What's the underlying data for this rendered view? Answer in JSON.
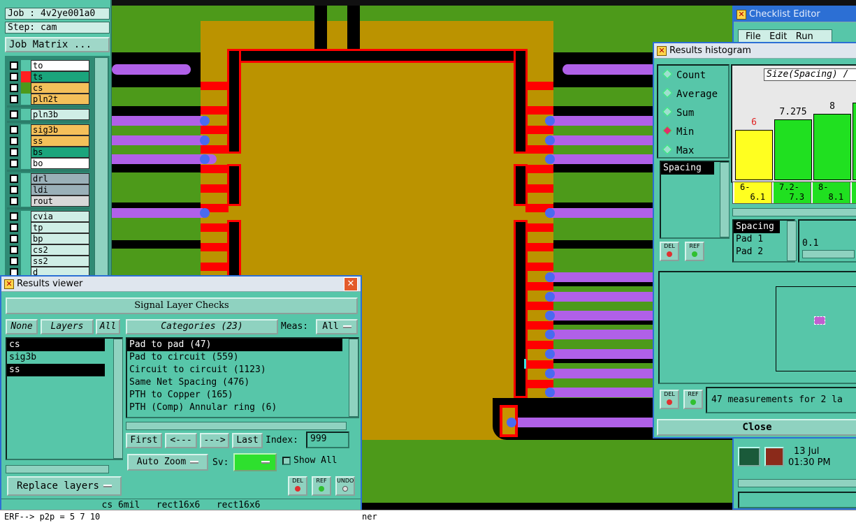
{
  "left_panel": {
    "job": "Job : 4v2ye001a0",
    "step": "Step: cam",
    "job_matrix": "Job Matrix ...",
    "layers": [
      {
        "name": "to",
        "color": "#ffffff",
        "swatch": "#57c6a9"
      },
      {
        "name": "ts",
        "color": "#1aa57c",
        "swatch": "#ff2020"
      },
      {
        "name": "cs",
        "color": "#f4c05a",
        "swatch": "#4d9a1a"
      },
      {
        "name": "pln2t",
        "color": "#f4c05a",
        "swatch": "#57c6a9"
      },
      {
        "name": "pln3b",
        "color": "#cfeee6",
        "swatch": "#57c6a9"
      },
      {
        "name": "sig3b",
        "color": "#f4c05a",
        "swatch": "#57c6a9"
      },
      {
        "name": "ss",
        "color": "#f4c05a",
        "swatch": "#57c6a9"
      },
      {
        "name": "bs",
        "color": "#1aa57c",
        "swatch": "#57c6a9"
      },
      {
        "name": "bo",
        "color": "#ffffff",
        "swatch": "#57c6a9"
      },
      {
        "name": "drl",
        "color": "#9ab0b8",
        "swatch": "#57c6a9"
      },
      {
        "name": "ldi",
        "color": "#9ab0b8",
        "swatch": "#57c6a9"
      },
      {
        "name": "rout",
        "color": "#d8d8d8",
        "swatch": "#57c6a9"
      },
      {
        "name": "cvia",
        "color": "#cfeee6",
        "swatch": "#57c6a9"
      },
      {
        "name": "tp",
        "color": "#cfeee6",
        "swatch": "#57c6a9"
      },
      {
        "name": "bp",
        "color": "#cfeee6",
        "swatch": "#57c6a9"
      },
      {
        "name": "cs2",
        "color": "#cfeee6",
        "swatch": "#57c6a9"
      },
      {
        "name": "ss2",
        "color": "#cfeee6",
        "swatch": "#57c6a9"
      },
      {
        "name": "d",
        "color": "#cfeee6",
        "swatch": "#57c6a9"
      }
    ]
  },
  "results_viewer": {
    "title": "Results viewer",
    "header": "Signal Layer Checks",
    "none_btn": "None",
    "layers_btn": "Layers",
    "all_btn": "All",
    "categories_btn": "Categories (23)",
    "meas_label": "Meas:",
    "meas_value": "All",
    "layer_list": [
      "cs",
      "sig3b",
      "ss"
    ],
    "layer_selected": [
      "cs",
      "ss"
    ],
    "categories": [
      "Pad to pad (47)",
      "Pad to circuit (559)",
      "Circuit to circuit (1123)",
      "Same Net Spacing (476)",
      "PTH to Copper (165)",
      "PTH (Comp) Annular ring (6)"
    ],
    "first": "First",
    "prev": "<---",
    "next": "--->",
    "last": "Last",
    "index_label": "Index:",
    "index_value": "999",
    "auto_zoom": "Auto Zoom",
    "sv_label": "Sv:",
    "show_all": "Show All",
    "replace_layers": "Replace layers",
    "del": "DEL",
    "ref": "REF",
    "undo": "UNDO",
    "status": "cs 6mil   rect16x6   rect16x6"
  },
  "histogram": {
    "title": "Results histogram",
    "modes": [
      "Count",
      "Average",
      "Sum",
      "Min",
      "Max"
    ],
    "selected_mode": "Min",
    "list_items": [
      "Spacing"
    ],
    "chart_header": "Size(Spacing) /",
    "bars": [
      {
        "value": "6",
        "range": "6-\n  6.1",
        "color": "#ffff20",
        "frac": 0.55
      },
      {
        "value": "7.275",
        "range": "7.2-\n  7.3",
        "color": "#20e020",
        "frac": 0.67
      },
      {
        "value": "8",
        "range": "8-\n  8.1",
        "color": "#20e020",
        "frac": 0.73
      },
      {
        "value": "",
        "range": "",
        "color": "#20e020",
        "frac": 0.85
      }
    ],
    "detail_items": [
      "Spacing",
      "Pad 1",
      "Pad 2"
    ],
    "detail_value": "0.1",
    "measurement_text": "47 measurements for 2 la",
    "close": "Close"
  },
  "checklist": {
    "title": "Checklist Editor",
    "menu": [
      "File",
      "Edit",
      "Run"
    ],
    "date": "13 Jul",
    "time": "01:30 PM"
  },
  "statusbar": {
    "text": "ERF--> p2p = 5 7 10",
    "tail": "ner"
  }
}
